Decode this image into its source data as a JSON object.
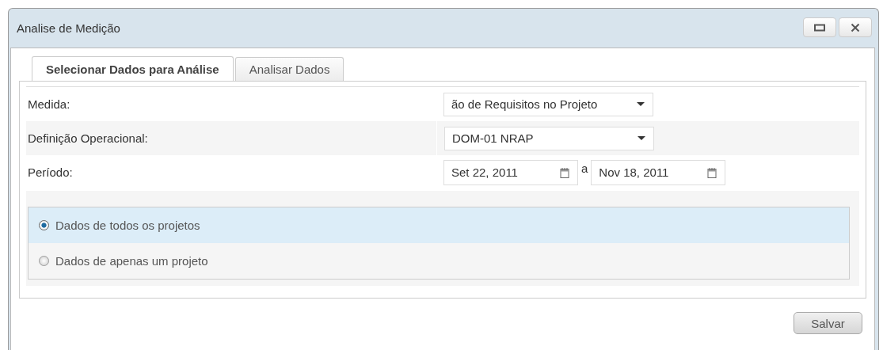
{
  "window": {
    "title": "Analise de Medição",
    "controls": [
      {
        "kind": "maximize"
      },
      {
        "kind": "close"
      }
    ]
  },
  "tabs": [
    {
      "label": "Selecionar Dados para Análise",
      "selected": true
    },
    {
      "label": "Analisar Dados",
      "selected": false
    }
  ],
  "form_rows": [
    {
      "kind": "select",
      "label": "Medida:",
      "value": "ão de Requisitos no Projeto"
    },
    {
      "kind": "select",
      "label": "Definição Operacional:",
      "value": "DOM-01 NRAP"
    },
    {
      "kind": "daterange",
      "label": "Período:",
      "from": "Set 22, 2011",
      "separator": "a",
      "to": "Nov 18, 2011"
    }
  ],
  "data_scope": [
    {
      "label": "Dados de todos os projetos",
      "selected": true
    },
    {
      "label": "Dados de apenas um projeto",
      "selected": false
    }
  ],
  "buttons": [
    "Salvar"
  ]
}
